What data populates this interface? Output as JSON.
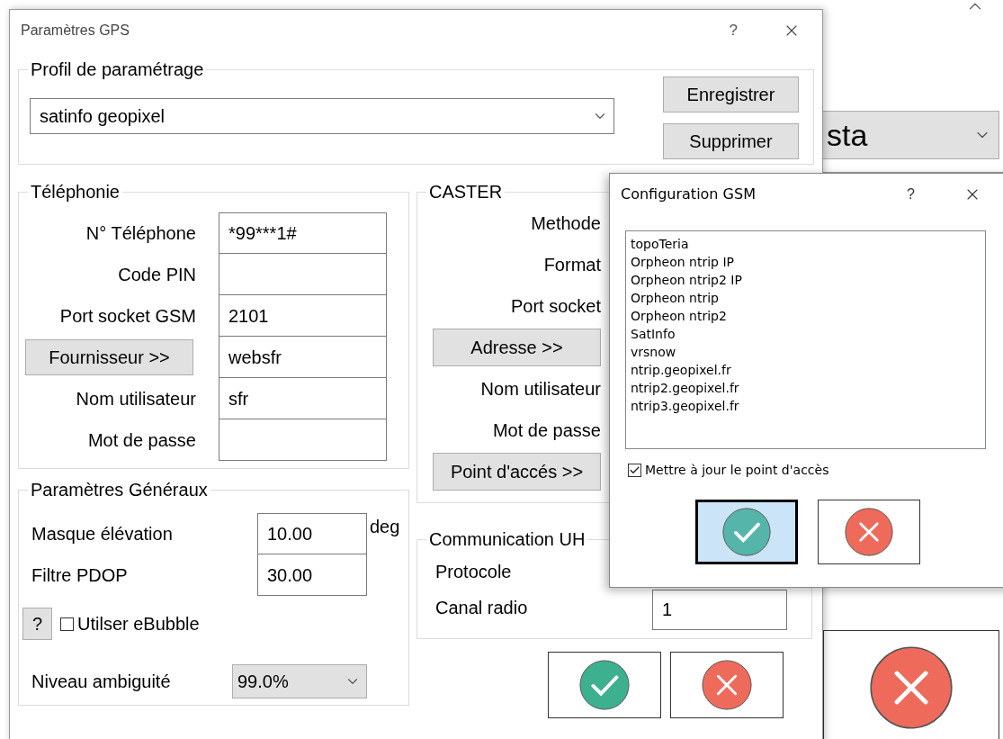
{
  "background": {
    "combo_value": "sta",
    "cancel_button": {
      "kind": "cancel"
    }
  },
  "main_window": {
    "title": "Paramètres GPS",
    "help": "?"
  },
  "profile": {
    "legend": "Profil de paramétrage",
    "value": "satinfo geopixel",
    "buttons": [
      "Enregistrer",
      "Supprimer"
    ]
  },
  "telephonie": {
    "legend": "Téléphonie",
    "rows": [
      {
        "kind": "label",
        "label": "N° Téléphone",
        "value": "*99***1#"
      },
      {
        "kind": "label",
        "label": "Code PIN"
      },
      {
        "kind": "label",
        "label": "Port socket GSM",
        "value": "2101"
      },
      {
        "kind": "button",
        "label": "Fournisseur >>",
        "value": "websfr"
      },
      {
        "kind": "label",
        "label": "Nom utilisateur",
        "value": "sfr"
      },
      {
        "kind": "label",
        "label": "Mot de passe"
      }
    ]
  },
  "caster": {
    "legend": "CASTER",
    "rows": [
      {
        "kind": "label",
        "label": "Methode"
      },
      {
        "kind": "label",
        "label": "Format"
      },
      {
        "kind": "label",
        "label": "Port socket"
      },
      {
        "kind": "button",
        "label": "Adresse >>"
      },
      {
        "kind": "label",
        "label": "Nom utilisateur"
      },
      {
        "kind": "label",
        "label": "Mot de passe"
      },
      {
        "kind": "button",
        "label": "Point d'accés >>"
      }
    ]
  },
  "general": {
    "legend": "Paramètres Généraux",
    "fields": [
      {
        "label": "Masque élévation",
        "value": "10.00",
        "unit": "deg"
      },
      {
        "label": "Filtre PDOP",
        "value": "30.00"
      }
    ],
    "help": "?",
    "ebubble": {
      "label": "Utilser eBubble",
      "checked": false
    },
    "ambiguity": {
      "label": "Niveau ambiguité",
      "value": "99.0%"
    }
  },
  "uhf": {
    "legend": "Communication UH",
    "rows": [
      {
        "label": "Protocole"
      },
      {
        "label": "Canal radio",
        "value": "1"
      }
    ]
  },
  "main_buttons": [
    {
      "kind": "ok",
      "focused": false
    },
    {
      "kind": "cancel",
      "focused": false
    }
  ],
  "gsm_dialog": {
    "title": "Configuration GSM",
    "help": "?",
    "items": [
      {
        "label": "topoTeria",
        "selected": false
      },
      {
        "label": "Orpheon ntrip IP",
        "selected": false
      },
      {
        "label": "Orpheon ntrip2 IP",
        "selected": false
      },
      {
        "label": "Orpheon ntrip",
        "selected": false
      },
      {
        "label": "Orpheon ntrip2",
        "selected": false
      },
      {
        "label": "SatInfo",
        "selected": false
      },
      {
        "label": "vrsnow",
        "selected": false
      },
      {
        "label": "ntrip.geopixel.fr",
        "selected": false
      },
      {
        "label": "ntrip2.geopixel.fr",
        "selected": false
      },
      {
        "label": "ntrip3.geopixel.fr",
        "selected": false
      }
    ],
    "update": {
      "label": "Mettre à jour le point d'accès",
      "checked": true
    },
    "buttons": [
      {
        "kind": "ok",
        "focused": true
      },
      {
        "kind": "cancel",
        "focused": false
      }
    ]
  }
}
